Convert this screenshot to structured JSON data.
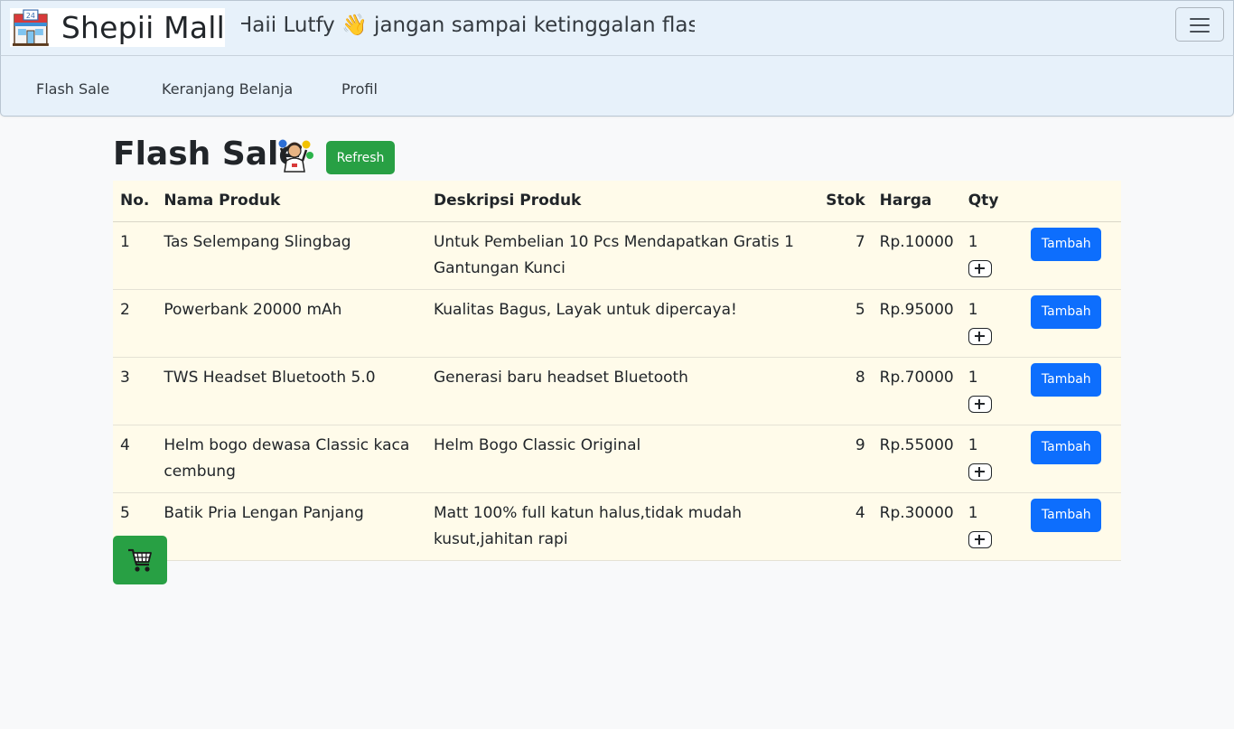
{
  "header": {
    "brand": "Shepii Mall",
    "brand_icon": "convenience-store-icon",
    "marquee": "Haii Lutfy 👋 jangan sampai ketinggalan flash",
    "menu_icon": "hamburger-menu-icon"
  },
  "nav": {
    "items": [
      {
        "label": "Flash Sale"
      },
      {
        "label": "Keranjang Belanja"
      },
      {
        "label": "Profil"
      }
    ]
  },
  "main": {
    "title": "Flash Sale",
    "title_icon": "juggler-emoji-icon",
    "refresh_label": "Refresh",
    "cart_icon": "shopping-cart-icon",
    "colors": {
      "success": "#28a044",
      "primary": "#0d6efd",
      "table_bg": "#fffbea",
      "nav_bg": "#e7f1fa"
    }
  },
  "table": {
    "headers": [
      "No.",
      "Nama Produk",
      "Deskripsi Produk",
      "Stok",
      "Harga",
      "Qty"
    ],
    "add_label": "Tambah",
    "rows": [
      {
        "no": "1",
        "name": "Tas Selempang Slingbag",
        "desc": "Untuk Pembelian 10 Pcs Mendapatkan Gratis 1 Gantungan Kunci",
        "stok": "7",
        "harga": "Rp.10000",
        "qty": "1"
      },
      {
        "no": "2",
        "name": "Powerbank 20000 mAh",
        "desc": "Kualitas Bagus, Layak untuk dipercaya!",
        "stok": "5",
        "harga": "Rp.95000",
        "qty": "1"
      },
      {
        "no": "3",
        "name": "TWS Headset Bluetooth 5.0",
        "desc": "Generasi baru headset Bluetooth",
        "stok": "8",
        "harga": "Rp.70000",
        "qty": "1"
      },
      {
        "no": "4",
        "name": "Helm bogo dewasa Classic kaca cembung",
        "desc": "Helm Bogo Classic Original",
        "stok": "9",
        "harga": "Rp.55000",
        "qty": "1"
      },
      {
        "no": "5",
        "name": "Batik Pria Lengan Panjang",
        "desc": "Matt 100% full katun halus,tidak mudah kusut,jahitan rapi",
        "stok": "4",
        "harga": "Rp.30000",
        "qty": "1"
      }
    ]
  }
}
